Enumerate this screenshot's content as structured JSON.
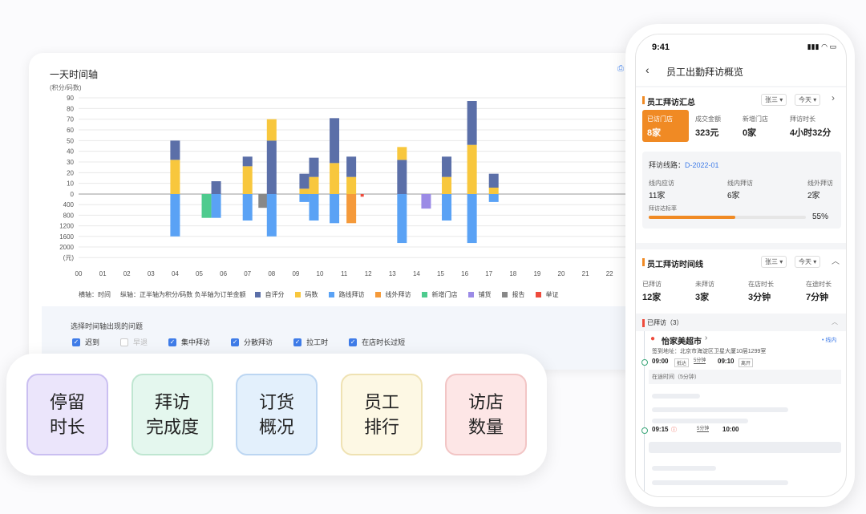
{
  "dashboard": {
    "title": "一天时间轴",
    "unit_label": "(积分/码数)",
    "corner_icon": "chart-export-icon"
  },
  "chart_data": {
    "type": "bar",
    "title": "一天时间轴",
    "xlabel": "横轴：时间",
    "ylabel": "纵轴：正半轴为积分/码数  负半轴为订单金额",
    "x_ticks": [
      "00",
      "01",
      "02",
      "03",
      "04",
      "05",
      "06",
      "07",
      "08",
      "09",
      "10",
      "11",
      "12",
      "13",
      "14",
      "15",
      "16",
      "17",
      "18",
      "19",
      "20",
      "21",
      "22"
    ],
    "pos_ticks": [
      "90",
      "80",
      "70",
      "60",
      "50",
      "40",
      "30",
      "20",
      "10",
      "0"
    ],
    "neg_ticks": [
      "400",
      "800",
      "1200",
      "1600",
      "2000",
      "(元)"
    ],
    "pos_ylim": [
      0,
      90
    ],
    "neg_ylim": [
      0,
      2000
    ],
    "grid": true,
    "colors": {
      "自评分": "#5b6fa8",
      "码数": "#f8c73d",
      "路线拜访": "#5aa2f5",
      "线外拜访": "#f59a3a",
      "新增门店": "#4ecb8e",
      "铺货": "#9b8be6",
      "报告": "#888888",
      "举证": "#ee4b3c"
    },
    "bars": [
      {
        "x": 4.0,
        "pos": [
          [
            "码数",
            32
          ],
          [
            "自评分",
            18
          ]
        ],
        "neg": [
          [
            "路线拜访",
            1600
          ]
        ]
      },
      {
        "x": 5.3,
        "pos": [],
        "neg": [
          [
            "新增门店",
            900
          ]
        ]
      },
      {
        "x": 5.7,
        "pos": [
          [
            "自评分",
            12
          ]
        ],
        "neg": [
          [
            "路线拜访",
            900
          ]
        ]
      },
      {
        "x": 7.0,
        "pos": [
          [
            "码数",
            26
          ],
          [
            "自评分",
            9
          ]
        ],
        "neg": [
          [
            "路线拜访",
            1000
          ]
        ]
      },
      {
        "x": 7.65,
        "pos": [],
        "neg": [
          [
            "报告",
            520
          ]
        ]
      },
      {
        "x": 8.0,
        "pos": [
          [
            "自评分",
            50
          ],
          [
            "码数",
            20
          ]
        ],
        "neg": [
          [
            "路线拜访",
            1600
          ]
        ]
      },
      {
        "x": 9.35,
        "pos": [
          [
            "码数",
            5
          ],
          [
            "自评分",
            14
          ]
        ],
        "neg": [
          [
            "路线拜访",
            300
          ]
        ]
      },
      {
        "x": 9.75,
        "pos": [
          [
            "码数",
            16
          ],
          [
            "自评分",
            18
          ]
        ],
        "neg": [
          [
            "路线拜访",
            1000
          ]
        ]
      },
      {
        "x": 10.6,
        "pos": [
          [
            "码数",
            29
          ],
          [
            "自评分",
            42
          ]
        ],
        "neg": [
          [
            "路线拜访",
            1100
          ]
        ]
      },
      {
        "x": 11.3,
        "pos": [
          [
            "码数",
            16
          ],
          [
            "自评分",
            19
          ]
        ],
        "neg": [
          [
            "线外拜访",
            1100
          ]
        ]
      },
      {
        "x": 11.75,
        "pos": [],
        "neg": [
          [
            "举证",
            100
          ]
        ]
      },
      {
        "x": 13.4,
        "pos": [
          [
            "自评分",
            32
          ],
          [
            "码数",
            12
          ]
        ],
        "neg": [
          [
            "路线拜访",
            1850
          ]
        ]
      },
      {
        "x": 14.4,
        "pos": [],
        "neg": [
          [
            "铺货",
            550
          ]
        ]
      },
      {
        "x": 15.25,
        "pos": [
          [
            "码数",
            16
          ],
          [
            "自评分",
            19
          ]
        ],
        "neg": [
          [
            "路线拜访",
            1000
          ]
        ]
      },
      {
        "x": 16.3,
        "pos": [
          [
            "码数",
            46
          ],
          [
            "自评分",
            41
          ]
        ],
        "neg": [
          [
            "路线拜访",
            1850
          ]
        ]
      },
      {
        "x": 17.2,
        "pos": [
          [
            "码数",
            6
          ],
          [
            "自评分",
            13
          ]
        ],
        "neg": [
          [
            "路线拜访",
            300
          ]
        ]
      }
    ]
  },
  "legend": {
    "axis_notes": [
      "横轴：时间",
      "纵轴：正半轴为积分/码数  负半轴为订单金额"
    ],
    "items": [
      {
        "label": "自评分",
        "color": "#5b6fa8"
      },
      {
        "label": "码数",
        "color": "#f8c73d"
      },
      {
        "label": "路线拜访",
        "color": "#5aa2f5"
      },
      {
        "label": "线外拜访",
        "color": "#f59a3a"
      },
      {
        "label": "新增门店",
        "color": "#4ecb8e"
      },
      {
        "label": "铺货",
        "color": "#9b8be6"
      },
      {
        "label": "报告",
        "color": "#888888"
      },
      {
        "label": "举证",
        "color": "#ee4b3c"
      }
    ]
  },
  "filter": {
    "title": "选择时间轴出现的问题",
    "options": [
      {
        "label": "迟到",
        "checked": true
      },
      {
        "label": "早退",
        "checked": false
      },
      {
        "label": "集中拜访",
        "checked": true
      },
      {
        "label": "分散拜访",
        "checked": true
      },
      {
        "label": "拉工时",
        "checked": true
      },
      {
        "label": "在店时长过短",
        "checked": true
      }
    ]
  },
  "tiles": [
    {
      "line1": "停留",
      "line2": "时长"
    },
    {
      "line1": "拜访",
      "line2": "完成度"
    },
    {
      "line1": "订货",
      "line2": "概况"
    },
    {
      "line1": "员工",
      "line2": "排行"
    },
    {
      "line1": "访店",
      "line2": "数量"
    }
  ],
  "phone": {
    "status_time": "9:41",
    "title": "员工出勤拜访概览",
    "summary": {
      "title": "员工拜访汇总",
      "employee": "张三",
      "period": "今天",
      "stats": [
        {
          "label": "已访门店",
          "value": "8家"
        },
        {
          "label": "成交金额",
          "value": "323元"
        },
        {
          "label": "新增门店",
          "value": "0家"
        },
        {
          "label": "拜访时长",
          "value": "4小时32分"
        }
      ],
      "route_label": "拜访线路：",
      "route_code": "D-2022-01",
      "route_stats": [
        {
          "label": "线内应访",
          "value": "11家"
        },
        {
          "label": "线内拜访",
          "value": "6家"
        },
        {
          "label": "线外拜访",
          "value": "2家"
        }
      ],
      "rate_label": "拜访达标率",
      "rate_value": "55%",
      "rate": 0.55
    },
    "timeline": {
      "title": "员工拜访时间线",
      "employee": "张三",
      "period": "今天",
      "stats": [
        {
          "label": "已拜访",
          "value": "12家"
        },
        {
          "label": "未拜访",
          "value": "3家"
        },
        {
          "label": "在店时长",
          "value": "3分钟"
        },
        {
          "label": "在途时长",
          "value": "7分钟"
        }
      ],
      "visited_header": "已拜访（3）",
      "store_name": "怡家美超市",
      "store_tag": "线内",
      "sign_address": "签到地址：北京市海淀区卫星大厦10层1299室",
      "arrive_time": "09:00",
      "arrive_label": "抵达",
      "stay_duration": "5分钟",
      "leave_time": "09:10",
      "leave_label": "离开",
      "transit": "在途时间（5分钟）",
      "second_time": "09:15",
      "second_duration": "5分钟",
      "second_end": "10:00"
    }
  }
}
